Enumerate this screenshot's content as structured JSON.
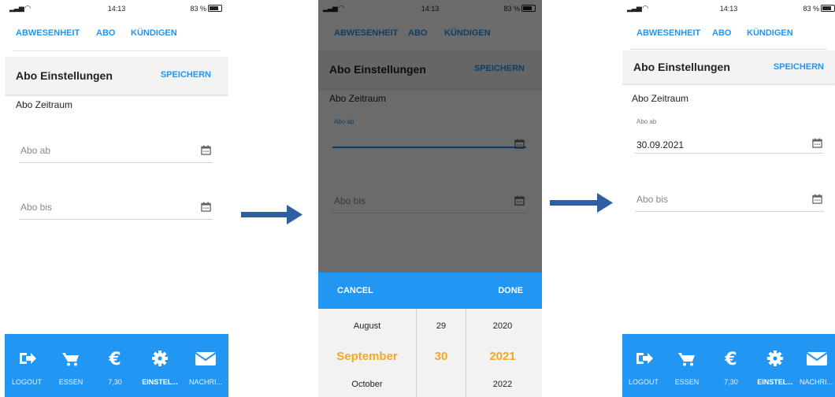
{
  "status": {
    "time": "14:13",
    "battery": "83 %"
  },
  "tabs": {
    "absence": "ABWESENHEIT",
    "abo": "ABO",
    "cancel": "KÜNDIGEN"
  },
  "header": {
    "title": "Abo Einstellungen",
    "save": "SPEICHERN"
  },
  "form": {
    "section": "Abo Zeitraum",
    "from_label": "Abo ab",
    "to_label": "Abo bis",
    "from_value": "30.09.2021"
  },
  "picker": {
    "cancel": "CANCEL",
    "done": "DONE",
    "months": [
      "August",
      "September",
      "October"
    ],
    "days": [
      "29",
      "30",
      ""
    ],
    "years": [
      "2020",
      "2021",
      "2022"
    ]
  },
  "nav": {
    "logout": "LOGOUT",
    "essen": "ESSEN",
    "balance": "7,30",
    "settings": "EINSTEL...",
    "messages": "NACHRI...",
    "settings_p3": "EINSTEL...",
    "messages_p3": "NACHRI..."
  },
  "colors": {
    "accent": "#2196f3",
    "picker_selected": "#f5a623",
    "arrow": "#2f5f9e"
  }
}
